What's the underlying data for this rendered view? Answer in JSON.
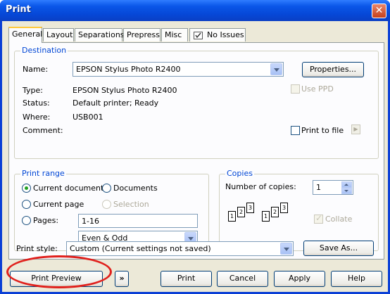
{
  "window": {
    "title": "Print",
    "close_symbol": "✕"
  },
  "tabs": [
    {
      "label": "General",
      "active": true
    },
    {
      "label": "Layout"
    },
    {
      "label": "Separations"
    },
    {
      "label": "Prepress"
    },
    {
      "label": "Misc"
    },
    {
      "label": "No Issues",
      "icon": "checklist-icon"
    }
  ],
  "destination": {
    "group_label": "Destination",
    "name_label": "Name:",
    "name_value": "EPSON Stylus Photo R2400",
    "properties_button": "Properties...",
    "use_ppd_label": "Use PPD",
    "type_label": "Type:",
    "type_value": "EPSON Stylus Photo R2400",
    "status_label": "Status:",
    "status_value": "Default printer; Ready",
    "where_label": "Where:",
    "where_value": "USB001",
    "comment_label": "Comment:",
    "print_to_file_label": "Print to file",
    "arrow_glyph": "▶"
  },
  "print_range": {
    "group_label": "Print range",
    "current_document": "Current document",
    "documents": "Documents",
    "current_page": "Current page",
    "selection": "Selection",
    "pages_label": "Pages:",
    "pages_value": "1-16",
    "page_set_value": "Even & Odd"
  },
  "copies": {
    "group_label": "Copies",
    "number_label": "Number of copies:",
    "number_value": "1",
    "collate_label": "Collate",
    "stack_a": [
      "1",
      "2",
      "3"
    ],
    "stack_b": [
      "1",
      "2",
      "3"
    ]
  },
  "print_style": {
    "label": "Print style:",
    "value": "Custom (Current settings not saved)",
    "save_as_button": "Save As..."
  },
  "footer": {
    "print_preview": "Print Preview",
    "more_glyph": "»",
    "print": "Print",
    "cancel": "Cancel",
    "apply": "Apply",
    "help": "Help"
  },
  "colors": {
    "title_bar": "#0a56e8",
    "panel": "#ece9d8",
    "accent": "#0046d5",
    "highlight": "#e0201c"
  }
}
